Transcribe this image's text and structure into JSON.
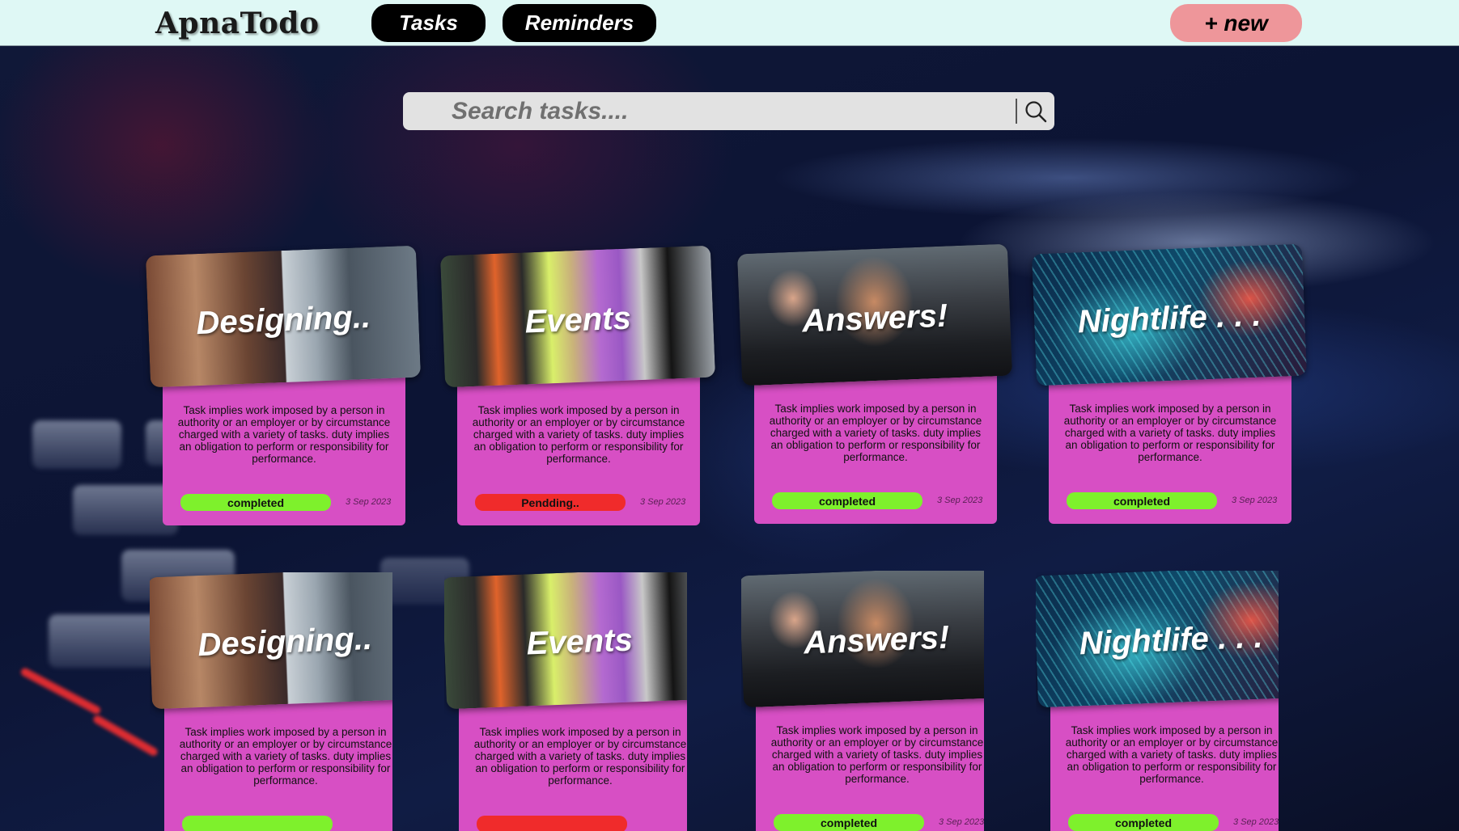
{
  "app": {
    "logo": "ApnaTodo"
  },
  "nav": {
    "tasks_label": "Tasks",
    "reminders_label": "Reminders",
    "new_label": "+ new"
  },
  "search": {
    "placeholder": "Search tasks...."
  },
  "cards": [
    {
      "title": "Designing..",
      "desc": "Task implies work imposed by a person in authority or an employer or by circumstance charged with a variety of tasks. duty implies an obligation to perform or responsibility for performance.",
      "status": "completed",
      "date": "3 Sep 2023"
    },
    {
      "title": "Events",
      "desc": "Task implies work imposed by a person in authority or an employer or by circumstance charged with a variety of tasks. duty implies an obligation to perform or responsibility for performance.",
      "status": "Pendding..",
      "date": "3 Sep 2023"
    },
    {
      "title": "Answers!",
      "desc": "Task implies work imposed by a person in authority or an employer or by circumstance charged with a variety of tasks. duty implies an obligation to perform or responsibility for performance.",
      "status": "completed",
      "date": "3 Sep 2023"
    },
    {
      "title": "Nightlife . . .",
      "desc": "Task implies work imposed by a person in authority or an employer or by circumstance charged with a variety of tasks. duty implies an obligation to perform or responsibility for performance.",
      "status": "completed",
      "date": "3 Sep 2023"
    },
    {
      "title": "Designing..",
      "desc": "Task implies work imposed by a person in authority or an employer or by circumstance charged with a variety of tasks. duty implies an obligation to perform or responsibility for performance.",
      "status": "",
      "date": ""
    },
    {
      "title": "Events",
      "desc": "Task implies work imposed by a person in authority or an employer or by circumstance charged with a variety of tasks. duty implies an obligation to perform or responsibility for performance.",
      "status": "",
      "date": ""
    },
    {
      "title": "Answers!",
      "desc": "Task implies work imposed by a person in authority or an employer or by circumstance charged with a variety of tasks. duty implies an obligation to perform or responsibility for performance.",
      "status": "completed",
      "date": "3 Sep 2023"
    },
    {
      "title": "Nightlife . . .",
      "desc": "Task implies work imposed by a person in authority or an employer or by circumstance charged with a variety of tasks. duty implies an obligation to perform or responsibility for performance.",
      "status": "completed",
      "date": "3 Sep 2023"
    }
  ],
  "colors": {
    "header_bg": "#dff8f5",
    "card_bg": "#d74fc4",
    "completed": "#7ef12c",
    "pending": "#f02b2b",
    "new_button": "#ee969a"
  }
}
